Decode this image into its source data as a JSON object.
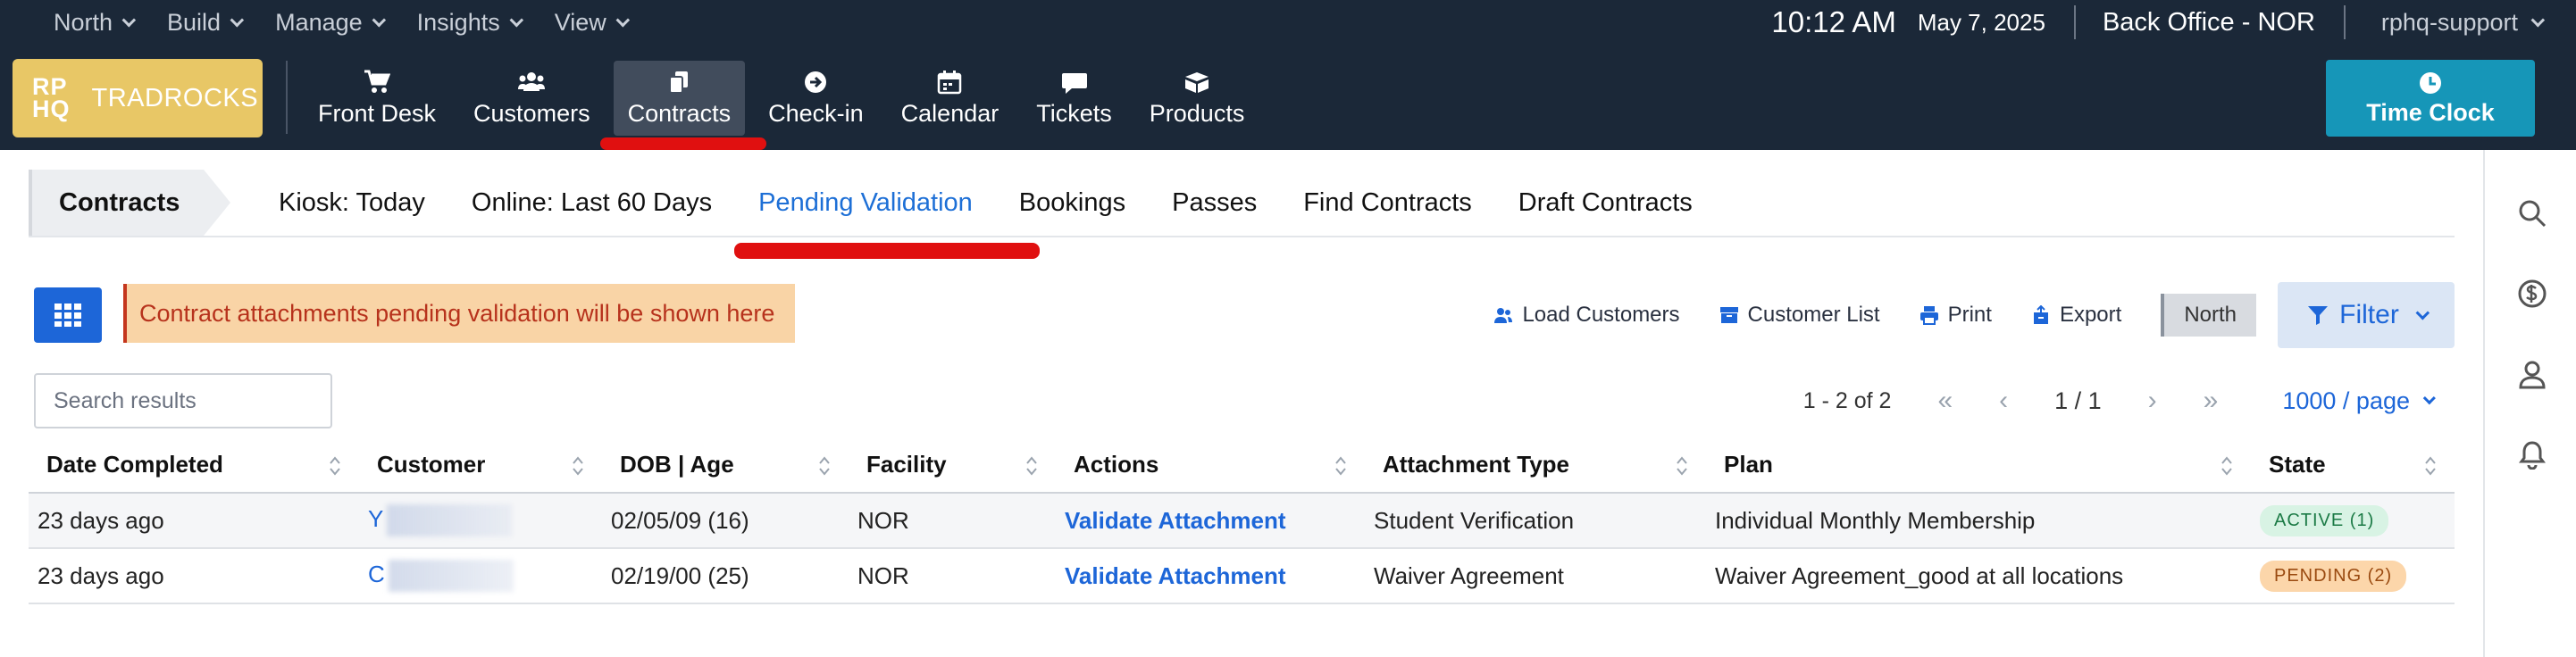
{
  "top_menu": {
    "items": [
      {
        "label": "North"
      },
      {
        "label": "Build"
      },
      {
        "label": "Manage"
      },
      {
        "label": "Insights"
      },
      {
        "label": "View"
      }
    ],
    "time": "10:12 AM",
    "date": "May 7, 2025",
    "location": "Back Office - NOR",
    "user": "rphq-support"
  },
  "brand": {
    "mark_top": "RP",
    "mark_bottom": "HQ",
    "name": "TRADROCKS",
    "color": "#e8c766"
  },
  "nav": {
    "items": [
      {
        "label": "Front Desk",
        "icon": "cart-icon"
      },
      {
        "label": "Customers",
        "icon": "users-icon"
      },
      {
        "label": "Contracts",
        "icon": "documents-icon",
        "active": true
      },
      {
        "label": "Check-in",
        "icon": "arrow-circle-icon"
      },
      {
        "label": "Calendar",
        "icon": "calendar-icon"
      },
      {
        "label": "Tickets",
        "icon": "chat-bubble-icon"
      },
      {
        "label": "Products",
        "icon": "boxes-icon"
      }
    ],
    "time_clock_label": "Time Clock"
  },
  "subnav": {
    "breadcrumb": "Contracts",
    "tabs": [
      {
        "label": "Kiosk: Today"
      },
      {
        "label": "Online: Last 60 Days"
      },
      {
        "label": "Pending Validation",
        "active": true
      },
      {
        "label": "Bookings"
      },
      {
        "label": "Passes"
      },
      {
        "label": "Find Contracts"
      },
      {
        "label": "Draft Contracts"
      }
    ]
  },
  "toolbar": {
    "alert": "Contract attachments pending validation will be shown here",
    "load_customers": "Load Customers",
    "customer_list": "Customer List",
    "print": "Print",
    "export": "Export",
    "location_badge": "North",
    "filter": "Filter"
  },
  "search": {
    "placeholder": "Search results",
    "value": ""
  },
  "pager": {
    "count": "1 - 2 of 2",
    "page": "1 / 1",
    "page_size": "1000 / page"
  },
  "table": {
    "columns": [
      "Date Completed",
      "Customer",
      "DOB | Age",
      "Facility",
      "Actions",
      "Attachment Type",
      "Plan",
      "State"
    ],
    "rows": [
      {
        "date_completed": "23 days ago",
        "customer": "Y",
        "dob_age": "02/05/09 (16)",
        "facility": "NOR",
        "action": "Validate Attachment",
        "attachment_type": "Student Verification",
        "plan": "Individual Monthly Membership",
        "state": "ACTIVE (1)"
      },
      {
        "date_completed": "23 days ago",
        "customer": "C",
        "dob_age": "02/19/00 (25)",
        "facility": "NOR",
        "action": "Validate Attachment",
        "attachment_type": "Waiver Agreement",
        "plan": "Waiver Agreement_good at all locations",
        "state": "PENDING (2)"
      }
    ]
  },
  "colors": {
    "header_bg": "#1b2838",
    "accent_blue": "#1d66d8",
    "time_clock": "#1696b8",
    "annotation_red": "#e01010"
  }
}
